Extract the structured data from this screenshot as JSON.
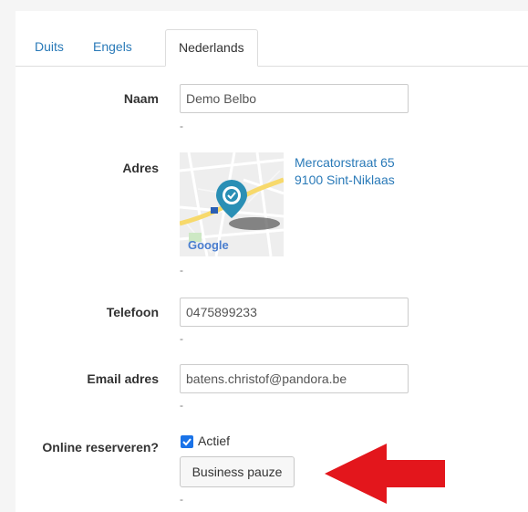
{
  "tabs": [
    {
      "label": "Duits",
      "active": false
    },
    {
      "label": "Engels",
      "active": false
    },
    {
      "label": "Nederlands",
      "active": true
    }
  ],
  "form": {
    "naam": {
      "label": "Naam",
      "value": "Demo Belbo",
      "hint": "-"
    },
    "adres": {
      "label": "Adres",
      "street": "Mercatorstraat 65",
      "city": "9100 Sint-Niklaas",
      "map_logo": "Google",
      "hint": "-"
    },
    "telefoon": {
      "label": "Telefoon",
      "value": "0475899233",
      "hint": "-"
    },
    "email": {
      "label": "Email adres",
      "value": "batens.christof@pandora.be",
      "hint": "-"
    },
    "online": {
      "label": "Online reserveren?",
      "checkbox_label": "Actief",
      "checked": true,
      "button_label": "Business pauze",
      "hint": "-"
    }
  },
  "colors": {
    "link": "#2a7ab8",
    "arrow": "#e3161c",
    "pin": "#2a8fb5",
    "checkbox": "#1a73e8"
  },
  "icons": [
    "map-pin-icon",
    "checkmark-icon",
    "red-arrow-icon"
  ]
}
